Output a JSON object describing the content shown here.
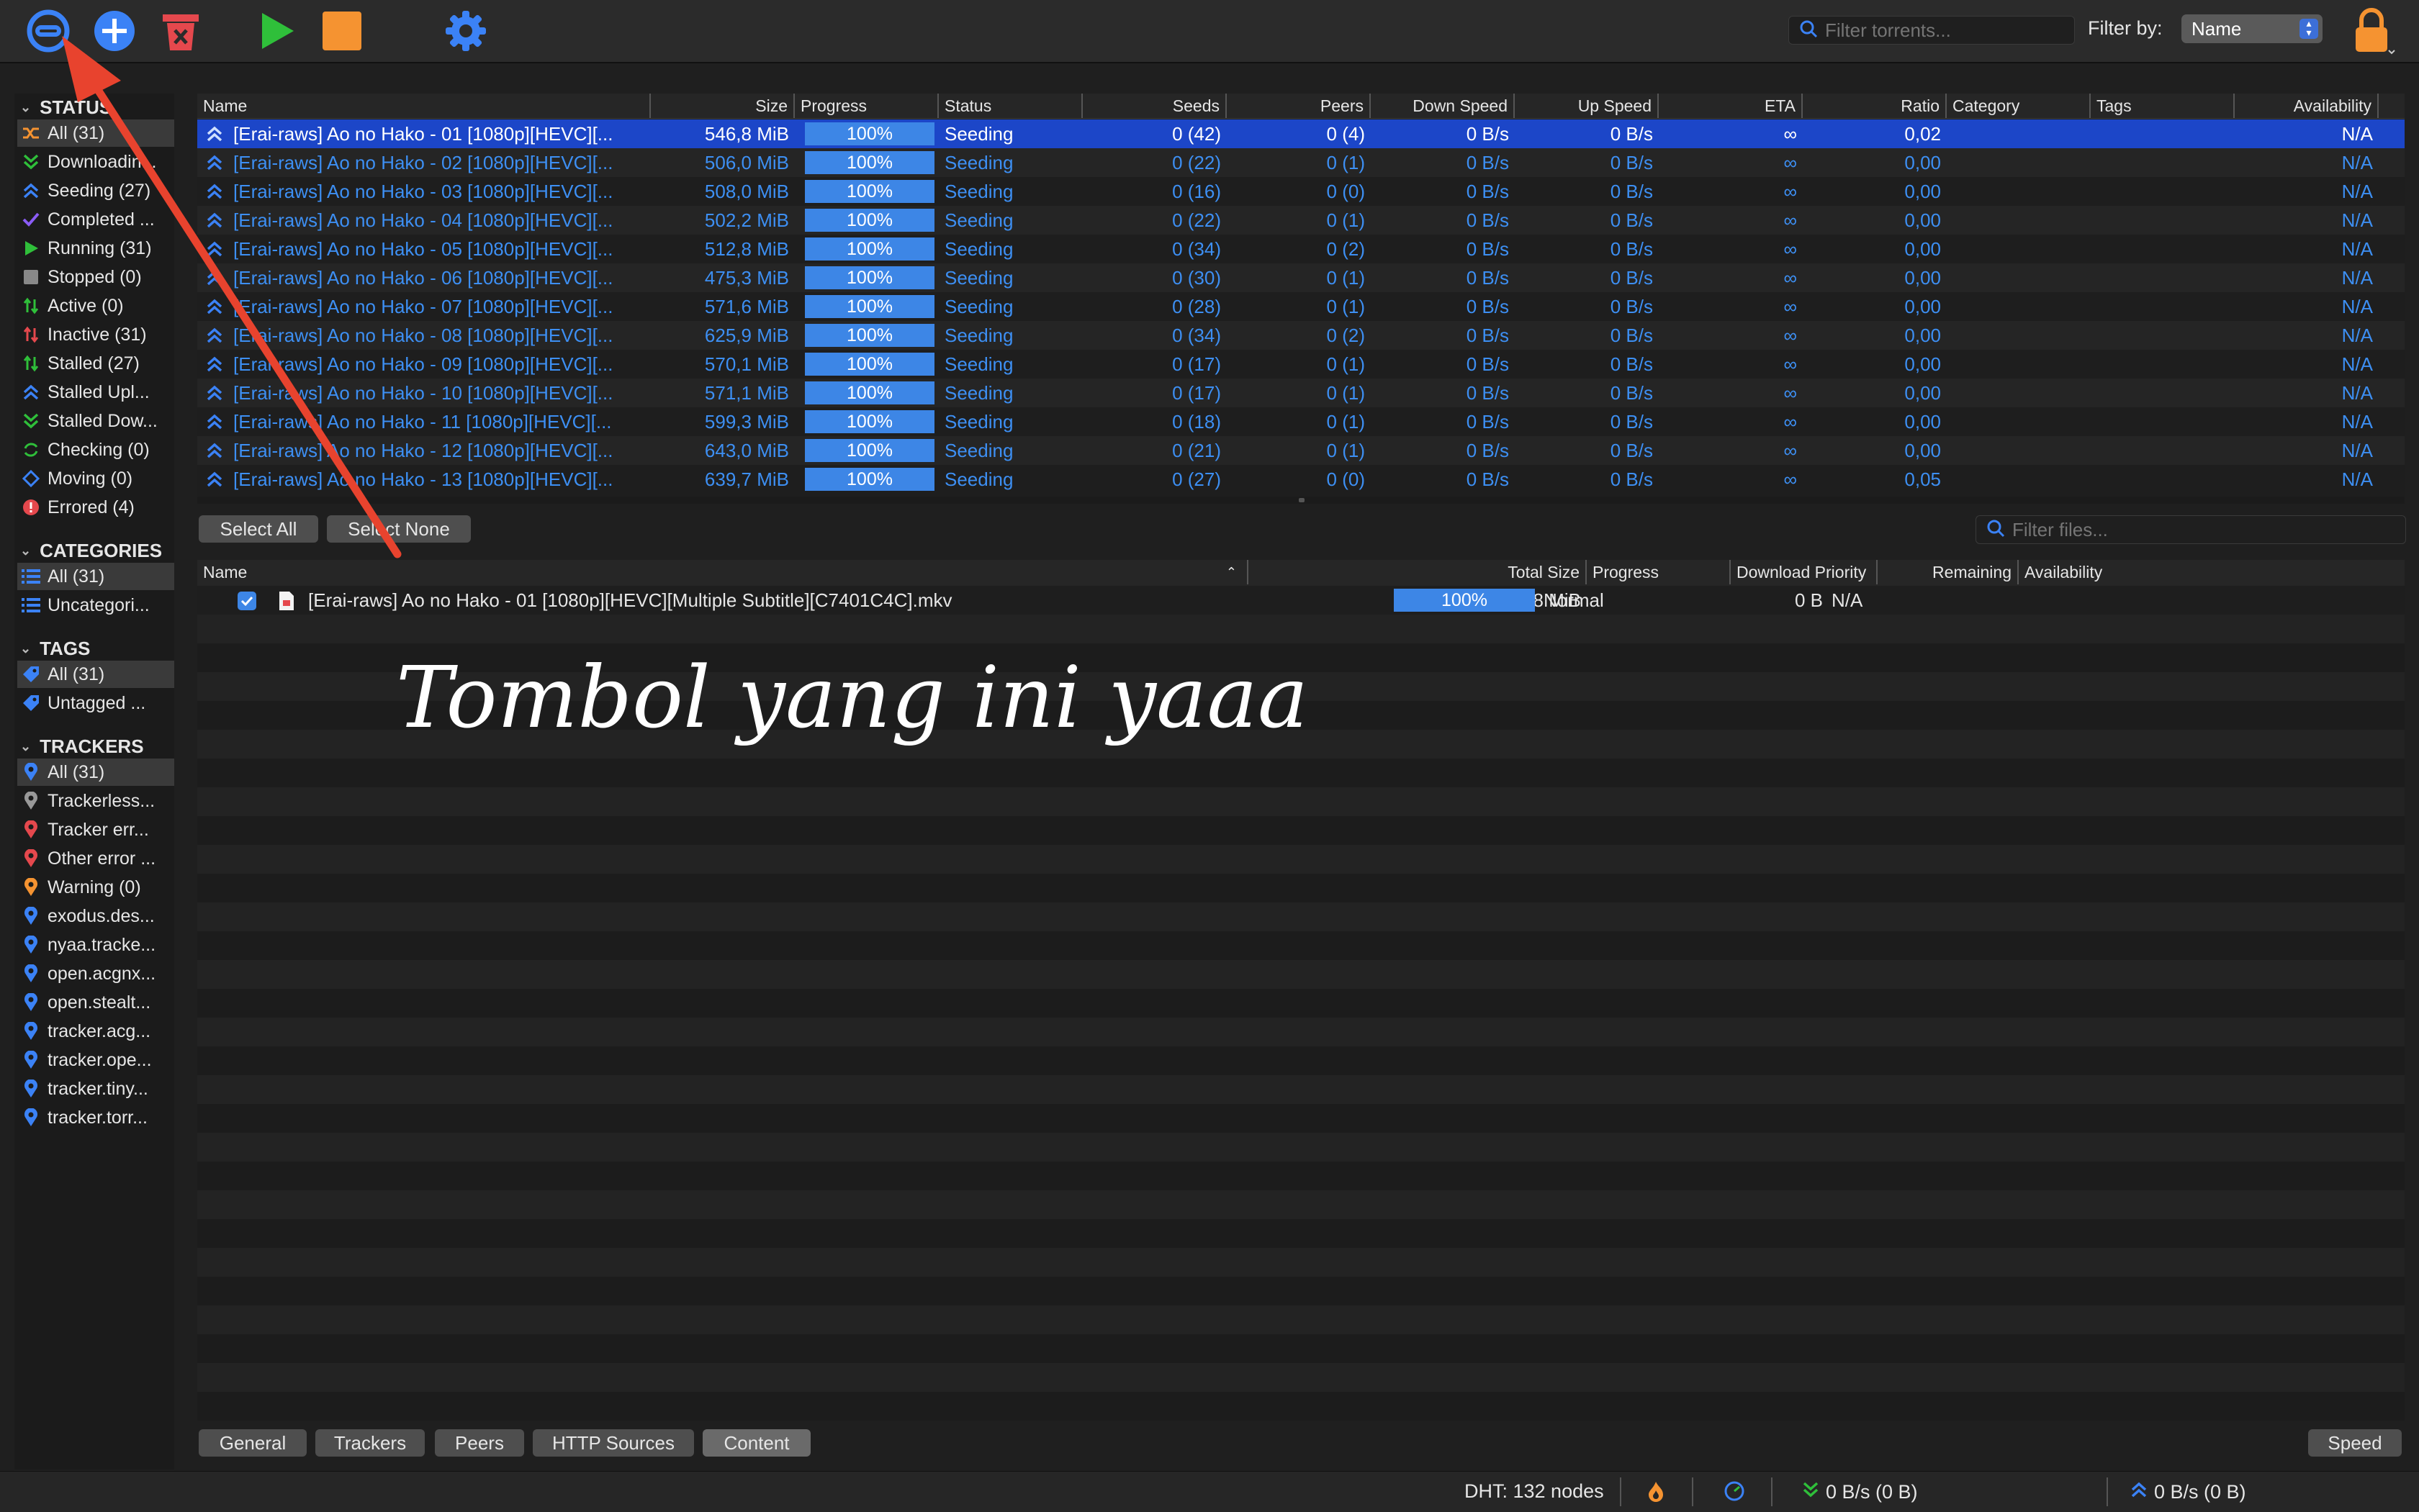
{
  "toolbar": {
    "buttons": [
      {
        "name": "torrent-link-icon",
        "color": "#3b82f6"
      },
      {
        "name": "add-torrent-icon",
        "color": "#3b82f6"
      },
      {
        "name": "delete-torrent-icon",
        "color": "#e5484d"
      },
      {
        "name": "resume-icon",
        "color": "#2fbf3a"
      },
      {
        "name": "pause-icon",
        "color": "#f59331"
      },
      {
        "name": "settings-gear-icon",
        "color": "#3b82f6"
      }
    ],
    "search_placeholder": "Filter torrents...",
    "filter_by_label": "Filter by:",
    "filter_by_value": "Name",
    "lock_icon": "lock-icon"
  },
  "sidebar": {
    "status_header": "STATUS",
    "status_items": [
      {
        "label": "All (31)",
        "icon": "all-shuffle-icon",
        "color": "#f59331"
      },
      {
        "label": "Downloadin...",
        "icon": "download-icon",
        "color": "#2fbf3a"
      },
      {
        "label": "Seeding (27)",
        "icon": "seeding-icon",
        "color": "#3b82f6"
      },
      {
        "label": "Completed ...",
        "icon": "check-icon",
        "color": "#8b5cf6"
      },
      {
        "label": "Running (31)",
        "icon": "play-icon",
        "color": "#2fbf3a"
      },
      {
        "label": "Stopped (0)",
        "icon": "stop-icon",
        "color": "#888888"
      },
      {
        "label": "Active (0)",
        "icon": "active-icon",
        "color": "#2fbf3a"
      },
      {
        "label": "Inactive (31)",
        "icon": "inactive-icon",
        "color": "#e5484d"
      },
      {
        "label": "Stalled (27)",
        "icon": "stalled-icon",
        "color": "#2fbf3a"
      },
      {
        "label": "Stalled Upl...",
        "icon": "stalled-up-icon",
        "color": "#3b82f6"
      },
      {
        "label": "Stalled Dow...",
        "icon": "stalled-down-icon",
        "color": "#2fbf3a"
      },
      {
        "label": "Checking (0)",
        "icon": "checking-icon",
        "color": "#2fbf3a"
      },
      {
        "label": "Moving (0)",
        "icon": "moving-icon",
        "color": "#3b82f6"
      },
      {
        "label": "Errored (4)",
        "icon": "error-icon",
        "color": "#e5484d"
      }
    ],
    "categories_header": "CATEGORIES",
    "category_items": [
      {
        "label": "All (31)",
        "icon": "list-icon",
        "color": "#3b82f6"
      },
      {
        "label": "Uncategori...",
        "icon": "list-icon",
        "color": "#3b82f6"
      }
    ],
    "tags_header": "TAGS",
    "tag_items": [
      {
        "label": "All (31)",
        "icon": "tag-icon",
        "color": "#3b82f6"
      },
      {
        "label": "Untagged ...",
        "icon": "tag-icon",
        "color": "#3b82f6"
      }
    ],
    "trackers_header": "TRACKERS",
    "tracker_items": [
      {
        "label": "All (31)",
        "icon": "pin-icon",
        "color": "#3b82f6"
      },
      {
        "label": "Trackerless...",
        "icon": "pin-icon",
        "color": "#999999"
      },
      {
        "label": "Tracker err...",
        "icon": "pin-icon",
        "color": "#e5484d"
      },
      {
        "label": "Other error ...",
        "icon": "pin-icon",
        "color": "#e5484d"
      },
      {
        "label": "Warning (0)",
        "icon": "pin-icon",
        "color": "#f59331"
      },
      {
        "label": "exodus.des...",
        "icon": "pin-icon",
        "color": "#3b82f6"
      },
      {
        "label": "nyaa.tracke...",
        "icon": "pin-icon",
        "color": "#3b82f6"
      },
      {
        "label": "open.acgnx...",
        "icon": "pin-icon",
        "color": "#3b82f6"
      },
      {
        "label": "open.stealt...",
        "icon": "pin-icon",
        "color": "#3b82f6"
      },
      {
        "label": "tracker.acg...",
        "icon": "pin-icon",
        "color": "#3b82f6"
      },
      {
        "label": "tracker.ope...",
        "icon": "pin-icon",
        "color": "#3b82f6"
      },
      {
        "label": "tracker.tiny...",
        "icon": "pin-icon",
        "color": "#3b82f6"
      },
      {
        "label": "tracker.torr...",
        "icon": "pin-icon",
        "color": "#3b82f6"
      }
    ]
  },
  "torrent_table": {
    "columns": [
      "Name",
      "Size",
      "Progress",
      "Status",
      "Seeds",
      "Peers",
      "Down Speed",
      "Up Speed",
      "ETA",
      "Ratio",
      "Category",
      "Tags",
      "Availability"
    ],
    "rows": [
      {
        "name": "[Erai-raws] Ao no Hako - 01 [1080p][HEVC][...",
        "size": "546,8 MiB",
        "progress": "100%",
        "status": "Seeding",
        "seeds": "0 (42)",
        "peers": "0 (4)",
        "down": "0 B/s",
        "up": "0 B/s",
        "eta": "∞",
        "ratio": "0,02",
        "availability": "N/A"
      },
      {
        "name": "[Erai-raws] Ao no Hako - 02 [1080p][HEVC][...",
        "size": "506,0 MiB",
        "progress": "100%",
        "status": "Seeding",
        "seeds": "0 (22)",
        "peers": "0 (1)",
        "down": "0 B/s",
        "up": "0 B/s",
        "eta": "∞",
        "ratio": "0,00",
        "availability": "N/A"
      },
      {
        "name": "[Erai-raws] Ao no Hako - 03 [1080p][HEVC][...",
        "size": "508,0 MiB",
        "progress": "100%",
        "status": "Seeding",
        "seeds": "0 (16)",
        "peers": "0 (0)",
        "down": "0 B/s",
        "up": "0 B/s",
        "eta": "∞",
        "ratio": "0,00",
        "availability": "N/A"
      },
      {
        "name": "[Erai-raws] Ao no Hako - 04 [1080p][HEVC][...",
        "size": "502,2 MiB",
        "progress": "100%",
        "status": "Seeding",
        "seeds": "0 (22)",
        "peers": "0 (1)",
        "down": "0 B/s",
        "up": "0 B/s",
        "eta": "∞",
        "ratio": "0,00",
        "availability": "N/A"
      },
      {
        "name": "[Erai-raws] Ao no Hako - 05 [1080p][HEVC][...",
        "size": "512,8 MiB",
        "progress": "100%",
        "status": "Seeding",
        "seeds": "0 (34)",
        "peers": "0 (2)",
        "down": "0 B/s",
        "up": "0 B/s",
        "eta": "∞",
        "ratio": "0,00",
        "availability": "N/A"
      },
      {
        "name": "[Erai-raws] Ao no Hako - 06 [1080p][HEVC][...",
        "size": "475,3 MiB",
        "progress": "100%",
        "status": "Seeding",
        "seeds": "0 (30)",
        "peers": "0 (1)",
        "down": "0 B/s",
        "up": "0 B/s",
        "eta": "∞",
        "ratio": "0,00",
        "availability": "N/A"
      },
      {
        "name": "[Erai-raws] Ao no Hako - 07 [1080p][HEVC][...",
        "size": "571,6 MiB",
        "progress": "100%",
        "status": "Seeding",
        "seeds": "0 (28)",
        "peers": "0 (1)",
        "down": "0 B/s",
        "up": "0 B/s",
        "eta": "∞",
        "ratio": "0,00",
        "availability": "N/A"
      },
      {
        "name": "[Erai-raws] Ao no Hako - 08 [1080p][HEVC][...",
        "size": "625,9 MiB",
        "progress": "100%",
        "status": "Seeding",
        "seeds": "0 (34)",
        "peers": "0 (2)",
        "down": "0 B/s",
        "up": "0 B/s",
        "eta": "∞",
        "ratio": "0,00",
        "availability": "N/A"
      },
      {
        "name": "[Erai-raws] Ao no Hako - 09 [1080p][HEVC][...",
        "size": "570,1 MiB",
        "progress": "100%",
        "status": "Seeding",
        "seeds": "0 (17)",
        "peers": "0 (1)",
        "down": "0 B/s",
        "up": "0 B/s",
        "eta": "∞",
        "ratio": "0,00",
        "availability": "N/A"
      },
      {
        "name": "[Erai-raws] Ao no Hako - 10 [1080p][HEVC][...",
        "size": "571,1 MiB",
        "progress": "100%",
        "status": "Seeding",
        "seeds": "0 (17)",
        "peers": "0 (1)",
        "down": "0 B/s",
        "up": "0 B/s",
        "eta": "∞",
        "ratio": "0,00",
        "availability": "N/A"
      },
      {
        "name": "[Erai-raws] Ao no Hako - 11 [1080p][HEVC][...",
        "size": "599,3 MiB",
        "progress": "100%",
        "status": "Seeding",
        "seeds": "0 (18)",
        "peers": "0 (1)",
        "down": "0 B/s",
        "up": "0 B/s",
        "eta": "∞",
        "ratio": "0,00",
        "availability": "N/A"
      },
      {
        "name": "[Erai-raws] Ao no Hako - 12 [1080p][HEVC][...",
        "size": "643,0 MiB",
        "progress": "100%",
        "status": "Seeding",
        "seeds": "0 (21)",
        "peers": "0 (1)",
        "down": "0 B/s",
        "up": "0 B/s",
        "eta": "∞",
        "ratio": "0,00",
        "availability": "N/A"
      },
      {
        "name": "[Erai-raws] Ao no Hako - 13 [1080p][HEVC][...",
        "size": "639,7 MiB",
        "progress": "100%",
        "status": "Seeding",
        "seeds": "0 (27)",
        "peers": "0 (0)",
        "down": "0 B/s",
        "up": "0 B/s",
        "eta": "∞",
        "ratio": "0,05",
        "availability": "N/A"
      }
    ]
  },
  "content": {
    "select_all": "Select All",
    "select_none": "Select None",
    "filter_placeholder": "Filter files...",
    "columns": [
      "Name",
      "Total Size",
      "Progress",
      "Download Priority",
      "Remaining",
      "Availability"
    ],
    "file": {
      "name": "[Erai-raws] Ao no Hako - 01 [1080p][HEVC][Multiple Subtitle][C7401C4C].mkv",
      "total_size": "546,8 MiB",
      "progress": "100%",
      "priority": "Normal",
      "remaining": "0 B",
      "availability": "N/A"
    }
  },
  "tabs": [
    "General",
    "Trackers",
    "Peers",
    "HTTP Sources",
    "Content"
  ],
  "active_tab": "Content",
  "speed_button": "Speed",
  "status_bar": {
    "dht": "DHT: 132 nodes",
    "down": "0 B/s (0 B)",
    "up": "0 B/s (0 B)"
  },
  "annotation": "Tombol yang ini yaaa",
  "colors": {
    "accent": "#3d86e6",
    "selected_row": "#1c46c8",
    "arrow": "#e8432e"
  }
}
